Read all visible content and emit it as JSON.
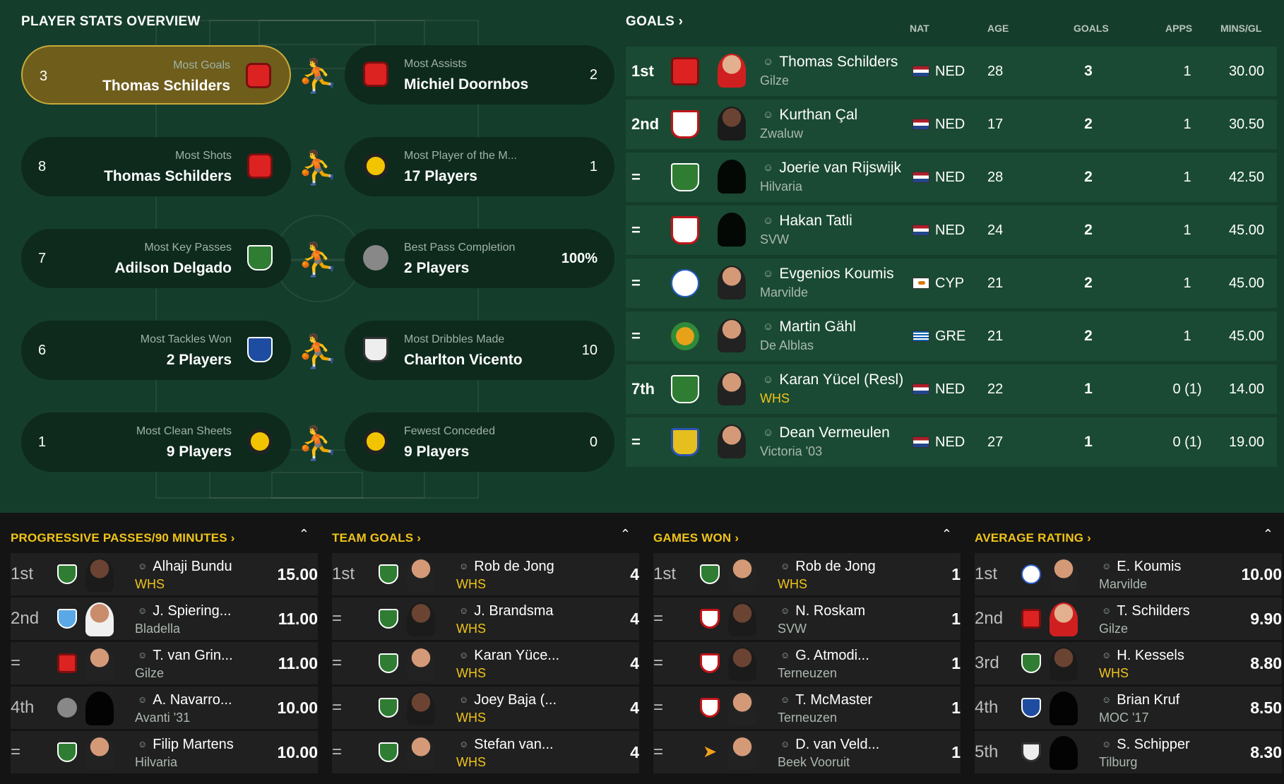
{
  "overview": {
    "title": "PLAYER STATS OVERVIEW",
    "cards_left": [
      {
        "value": "3",
        "caption": "Most Goals",
        "name": "Thomas Schilders",
        "crest": "gilze-crest",
        "color": "#d22222"
      },
      {
        "value": "8",
        "caption": "Most Shots",
        "name": "Thomas Schilders",
        "crest": "gilze-crest",
        "color": "#d22222"
      },
      {
        "value": "7",
        "caption": "Most Key Passes",
        "name": "Adilson Delgado",
        "crest": "whs-crest",
        "color": "#2e7d32"
      },
      {
        "value": "6",
        "caption": "Most Tackles Won",
        "name": "2 Players",
        "crest": "blue-white-crest",
        "color": "#1e4ca0"
      },
      {
        "value": "1",
        "caption": "Most Clean Sheets",
        "name": "9 Players",
        "crest": "yellow-c-crest",
        "color": "#f2c400"
      }
    ],
    "cards_right": [
      {
        "value": "2",
        "caption": "Most Assists",
        "name": "Michiel Doornbos",
        "crest": "gilze-crest",
        "color": "#d22222"
      },
      {
        "value": "1",
        "caption": "Most Player of the M...",
        "name": "17 Players",
        "crest": "yellow-c-crest",
        "color": "#f2c400"
      },
      {
        "value": "100%",
        "caption": "Best Pass Completion",
        "name": "2 Players",
        "crest": "avanti-crest",
        "color": "#888888"
      },
      {
        "value": "10",
        "caption": "Most Dribbles Made",
        "name": "Charlton Vicento",
        "crest": "black-white-crest",
        "color": "#eeeeee"
      },
      {
        "value": "0",
        "caption": "Fewest Conceded",
        "name": "9 Players",
        "crest": "yellow-c-crest",
        "color": "#f2c400"
      }
    ],
    "figures": [
      "kicking-player-icon",
      "shooting-player-icon",
      "passing-player-icon",
      "tackling-player-icon",
      "diving-keeper-icon"
    ]
  },
  "goals": {
    "title": "GOALS",
    "columns": [
      "NAT",
      "AGE",
      "GOALS",
      "APPS",
      "MINS/GL"
    ],
    "rows": [
      {
        "rank": "1st",
        "name": "Thomas Schilders",
        "club": "Gilze",
        "nat": "NED",
        "age": "28",
        "goals": "3",
        "apps": "1",
        "mins": "30.00"
      },
      {
        "rank": "2nd",
        "name": "Kurthan Çal",
        "club": "Zwaluw",
        "nat": "NED",
        "age": "17",
        "goals": "2",
        "apps": "1",
        "mins": "30.50"
      },
      {
        "rank": "=",
        "name": "Joerie van Rijswijk",
        "club": "Hilvaria",
        "nat": "NED",
        "age": "28",
        "goals": "2",
        "apps": "1",
        "mins": "42.50"
      },
      {
        "rank": "=",
        "name": "Hakan Tatli",
        "club": "SVW",
        "nat": "NED",
        "age": "24",
        "goals": "2",
        "apps": "1",
        "mins": "45.00"
      },
      {
        "rank": "=",
        "name": "Evgenios Koumis",
        "club": "Marvilde",
        "nat": "CYP",
        "age": "21",
        "goals": "2",
        "apps": "1",
        "mins": "45.00"
      },
      {
        "rank": "=",
        "name": "Martin Gähl",
        "club": "De Alblas",
        "nat": "GRE",
        "age": "21",
        "goals": "2",
        "apps": "1",
        "mins": "45.00"
      },
      {
        "rank": "7th",
        "name": "Karan Yücel (Resl)",
        "club": "WHS",
        "nat": "NED",
        "age": "22",
        "goals": "1",
        "apps": "0 (1)",
        "mins": "14.00"
      },
      {
        "rank": "=",
        "name": "Dean Vermeulen",
        "club": "Victoria '03",
        "nat": "NED",
        "age": "27",
        "goals": "1",
        "apps": "0 (1)",
        "mins": "19.00"
      }
    ]
  },
  "panels": [
    {
      "title": "PROGRESSIVE PASSES/90 MINUTES",
      "rows": [
        {
          "rank": "1st",
          "name": "Alhaji Bundu",
          "club": "WHS",
          "value": "15.00"
        },
        {
          "rank": "2nd",
          "name": "J. Spiering...",
          "club": "Bladella",
          "value": "11.00"
        },
        {
          "rank": "=",
          "name": "T. van Grin...",
          "club": "Gilze",
          "value": "11.00"
        },
        {
          "rank": "4th",
          "name": "A. Navarro...",
          "club": "Avanti '31",
          "value": "10.00"
        },
        {
          "rank": "=",
          "name": "Filip Martens",
          "club": "Hilvaria",
          "value": "10.00"
        }
      ]
    },
    {
      "title": "TEAM GOALS",
      "rows": [
        {
          "rank": "1st",
          "name": "Rob de Jong",
          "club": "WHS",
          "value": "4"
        },
        {
          "rank": "=",
          "name": "J. Brandsma",
          "club": "WHS",
          "value": "4"
        },
        {
          "rank": "=",
          "name": "Karan Yüce...",
          "club": "WHS",
          "value": "4"
        },
        {
          "rank": "=",
          "name": "Joey Baja (...",
          "club": "WHS",
          "value": "4"
        },
        {
          "rank": "=",
          "name": "Stefan van...",
          "club": "WHS",
          "value": "4"
        }
      ]
    },
    {
      "title": "GAMES WON",
      "rows": [
        {
          "rank": "1st",
          "name": "Rob de Jong",
          "club": "WHS",
          "value": "1"
        },
        {
          "rank": "=",
          "name": "N. Roskam",
          "club": "SVW",
          "value": "1"
        },
        {
          "rank": "=",
          "name": "G. Atmodi...",
          "club": "Terneuzen",
          "value": "1"
        },
        {
          "rank": "=",
          "name": "T. McMaster",
          "club": "Terneuzen",
          "value": "1"
        },
        {
          "rank": "=",
          "name": "D. van Veld...",
          "club": "Beek Vooruit",
          "value": "1"
        }
      ]
    },
    {
      "title": "AVERAGE RATING",
      "rows": [
        {
          "rank": "1st",
          "name": "E. Koumis",
          "club": "Marvilde",
          "value": "10.00"
        },
        {
          "rank": "2nd",
          "name": "T. Schilders",
          "club": "Gilze",
          "value": "9.90"
        },
        {
          "rank": "3rd",
          "name": "H. Kessels",
          "club": "WHS",
          "value": "8.80"
        },
        {
          "rank": "4th",
          "name": "Brian Kruf",
          "club": "MOC '17",
          "value": "8.50"
        },
        {
          "rank": "5th",
          "name": "S. Schipper",
          "club": "Tilburg",
          "value": "8.30"
        }
      ]
    }
  ],
  "colors": {
    "panel_green": "#153d2b",
    "row_green": "#1a4a33",
    "highlight_gold": "#6f5d1c",
    "accent_yellow": "#f0c419"
  }
}
